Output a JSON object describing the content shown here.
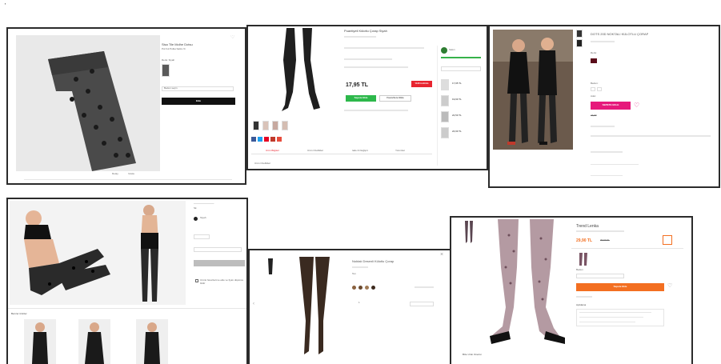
{
  "top_dot": "'",
  "s1": {
    "title": "Sisa Tile Molhe Dotsu",
    "subtitle": "Pol Ful Polka\nSatire %",
    "color_label": "Renk: Siyah",
    "size_label": "Beden seçin",
    "add_button": "Ekle",
    "footer_links": [
      "Detay",
      "İncele"
    ]
  },
  "s2": {
    "title": "Puantiyeli Külotlu Çorap Siyah",
    "price": "17,95 TL",
    "promo_badge": "%40 indirim",
    "cart_button": "Sepete Ekle",
    "fav_button": "Favorilere Ekle",
    "tabs": [
      "Ürün Bilgileri",
      "Ürün Özellikleri",
      "İade & Değişim",
      "Yorumlar"
    ],
    "section_label": "Ürün Özellikleri",
    "seller": "Satıcı",
    "side_items": [
      "17,95 TL",
      "19,90 TL",
      "22,50 TL",
      "24,90 TL"
    ]
  },
  "s3": {
    "title": "DOTS 20D NOKTALI KÜLOTLU ÇORAP",
    "price_old": "24,99",
    "cart_button": "SEPETE EKLE",
    "meta_labels": [
      "Renk:",
      "Beden:",
      "Adet:"
    ]
  },
  "s4": {
    "price_label": "Sk",
    "color_label": "Siyah",
    "checkbox_text": "Ürünü favorilerime ekle ve fiyatı düşünce bildir",
    "footer_heading": "Benzer ürünler"
  },
  "s5": {
    "title": "Noktalı Desenli Külotlu Çorap",
    "color_label": "Ten",
    "qty_label": "1",
    "close": "×",
    "colors": [
      "#8a6240",
      "#6b4a2f",
      "#a07a55",
      "#3d2a1e"
    ]
  },
  "s6": {
    "title": "Trend Lenka",
    "price": "29,90 TL",
    "price_old": "39,90 TL",
    "size_label": "Beden",
    "cart_button": "Sepete Ekle",
    "desc_heading": "Açıklama",
    "footer_heading": "Bize Ürün Önerisi"
  }
}
